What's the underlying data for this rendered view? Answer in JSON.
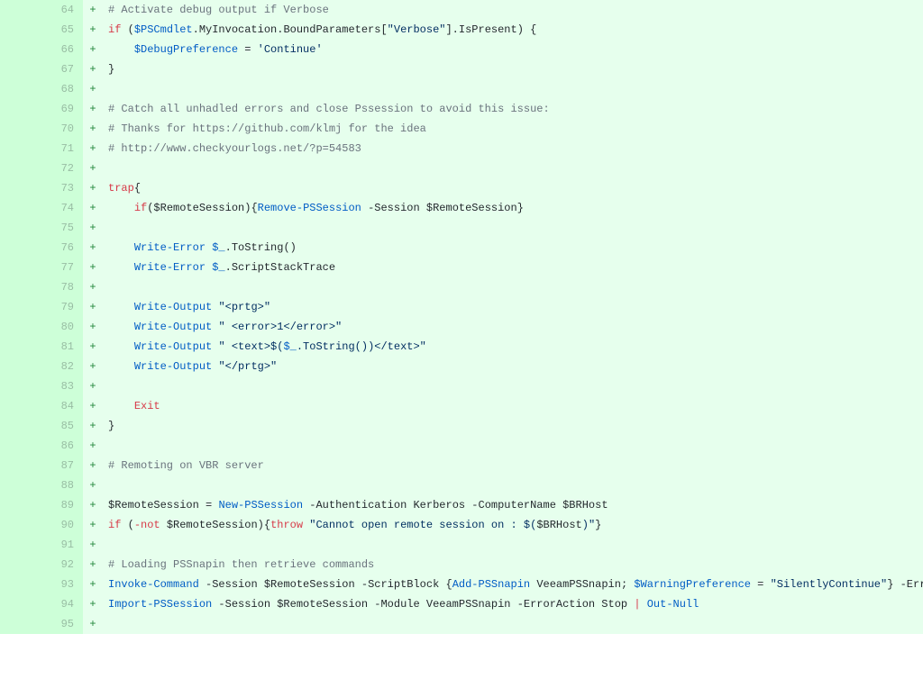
{
  "lines": [
    {
      "n": 64,
      "marker": "+",
      "tokens": [
        {
          "cls": "tok-comment",
          "t": "# Activate debug output if Verbose"
        }
      ]
    },
    {
      "n": 65,
      "marker": "+",
      "tokens": [
        {
          "cls": "tok-keyword",
          "t": "if"
        },
        {
          "cls": "tok-punct",
          "t": " ("
        },
        {
          "cls": "tok-builtin",
          "t": "$PSCmdlet"
        },
        {
          "cls": "tok-punct",
          "t": ".MyInvocation.BoundParameters["
        },
        {
          "cls": "tok-string",
          "t": "\"Verbose\""
        },
        {
          "cls": "tok-punct",
          "t": "].IsPresent) {"
        }
      ]
    },
    {
      "n": 66,
      "marker": "+",
      "tokens": [
        {
          "cls": "",
          "t": "    "
        },
        {
          "cls": "tok-builtin",
          "t": "$DebugPreference"
        },
        {
          "cls": "tok-punct",
          "t": " = "
        },
        {
          "cls": "tok-string",
          "t": "'Continue'"
        }
      ]
    },
    {
      "n": 67,
      "marker": "+",
      "tokens": [
        {
          "cls": "tok-punct",
          "t": "}"
        }
      ]
    },
    {
      "n": 68,
      "marker": "+",
      "tokens": []
    },
    {
      "n": 69,
      "marker": "+",
      "tokens": [
        {
          "cls": "tok-comment",
          "t": "# Catch all unhadled errors and close Pssession to avoid this issue:"
        }
      ]
    },
    {
      "n": 70,
      "marker": "+",
      "tokens": [
        {
          "cls": "tok-comment",
          "t": "# Thanks for https://github.com/klmj for the idea"
        }
      ]
    },
    {
      "n": 71,
      "marker": "+",
      "tokens": [
        {
          "cls": "tok-comment",
          "t": "# http://www.checkyourlogs.net/?p=54583"
        }
      ]
    },
    {
      "n": 72,
      "marker": "+",
      "tokens": []
    },
    {
      "n": 73,
      "marker": "+",
      "tokens": [
        {
          "cls": "tok-keyword",
          "t": "trap"
        },
        {
          "cls": "tok-punct",
          "t": "{"
        }
      ]
    },
    {
      "n": 74,
      "marker": "+",
      "tokens": [
        {
          "cls": "",
          "t": "    "
        },
        {
          "cls": "tok-keyword",
          "t": "if"
        },
        {
          "cls": "tok-punct",
          "t": "("
        },
        {
          "cls": "tok-variable",
          "t": "$RemoteSession"
        },
        {
          "cls": "tok-punct",
          "t": "){"
        },
        {
          "cls": "tok-cmdlet",
          "t": "Remove-PSSession"
        },
        {
          "cls": "",
          "t": " "
        },
        {
          "cls": "tok-punct",
          "t": "-Session "
        },
        {
          "cls": "tok-variable",
          "t": "$RemoteSession"
        },
        {
          "cls": "tok-punct",
          "t": "}"
        }
      ]
    },
    {
      "n": 75,
      "marker": "+",
      "tokens": []
    },
    {
      "n": 76,
      "marker": "+",
      "tokens": [
        {
          "cls": "",
          "t": "    "
        },
        {
          "cls": "tok-cmdlet",
          "t": "Write-Error"
        },
        {
          "cls": "",
          "t": " "
        },
        {
          "cls": "tok-builtin",
          "t": "$_"
        },
        {
          "cls": "tok-punct",
          "t": ".ToString()"
        }
      ]
    },
    {
      "n": 77,
      "marker": "+",
      "tokens": [
        {
          "cls": "",
          "t": "    "
        },
        {
          "cls": "tok-cmdlet",
          "t": "Write-Error"
        },
        {
          "cls": "",
          "t": " "
        },
        {
          "cls": "tok-builtin",
          "t": "$_"
        },
        {
          "cls": "tok-punct",
          "t": ".ScriptStackTrace"
        }
      ]
    },
    {
      "n": 78,
      "marker": "+",
      "tokens": []
    },
    {
      "n": 79,
      "marker": "+",
      "tokens": [
        {
          "cls": "",
          "t": "    "
        },
        {
          "cls": "tok-cmdlet",
          "t": "Write-Output"
        },
        {
          "cls": "",
          "t": " "
        },
        {
          "cls": "tok-string",
          "t": "\"<prtg>\""
        }
      ]
    },
    {
      "n": 80,
      "marker": "+",
      "tokens": [
        {
          "cls": "",
          "t": "    "
        },
        {
          "cls": "tok-cmdlet",
          "t": "Write-Output"
        },
        {
          "cls": "",
          "t": " "
        },
        {
          "cls": "tok-string",
          "t": "\" <error>1</error>\""
        }
      ]
    },
    {
      "n": 81,
      "marker": "+",
      "tokens": [
        {
          "cls": "",
          "t": "    "
        },
        {
          "cls": "tok-cmdlet",
          "t": "Write-Output"
        },
        {
          "cls": "",
          "t": " "
        },
        {
          "cls": "tok-string",
          "t": "\" <text>$("
        },
        {
          "cls": "tok-builtin",
          "t": "$_"
        },
        {
          "cls": "tok-string",
          "t": ".ToString())</text>\""
        }
      ]
    },
    {
      "n": 82,
      "marker": "+",
      "tokens": [
        {
          "cls": "",
          "t": "    "
        },
        {
          "cls": "tok-cmdlet",
          "t": "Write-Output"
        },
        {
          "cls": "",
          "t": " "
        },
        {
          "cls": "tok-string",
          "t": "\"</prtg>\""
        }
      ]
    },
    {
      "n": 83,
      "marker": "+",
      "tokens": []
    },
    {
      "n": 84,
      "marker": "+",
      "tokens": [
        {
          "cls": "",
          "t": "    "
        },
        {
          "cls": "tok-keyword",
          "t": "Exit"
        }
      ]
    },
    {
      "n": 85,
      "marker": "+",
      "tokens": [
        {
          "cls": "tok-punct",
          "t": "}"
        }
      ]
    },
    {
      "n": 86,
      "marker": "+",
      "tokens": []
    },
    {
      "n": 87,
      "marker": "+",
      "tokens": [
        {
          "cls": "tok-comment",
          "t": "# Remoting on VBR server"
        }
      ]
    },
    {
      "n": 88,
      "marker": "+",
      "tokens": []
    },
    {
      "n": 89,
      "marker": "+",
      "tokens": [
        {
          "cls": "tok-variable",
          "t": "$RemoteSession"
        },
        {
          "cls": "tok-punct",
          "t": " = "
        },
        {
          "cls": "tok-cmdlet",
          "t": "New-PSSession"
        },
        {
          "cls": "",
          "t": " -Authentication Kerberos -ComputerName "
        },
        {
          "cls": "tok-variable",
          "t": "$BRHost"
        }
      ]
    },
    {
      "n": 90,
      "marker": "+",
      "tokens": [
        {
          "cls": "tok-keyword",
          "t": "if"
        },
        {
          "cls": "tok-punct",
          "t": " ("
        },
        {
          "cls": "tok-keyword",
          "t": "-not"
        },
        {
          "cls": "",
          "t": " "
        },
        {
          "cls": "tok-variable",
          "t": "$RemoteSession"
        },
        {
          "cls": "tok-punct",
          "t": "){"
        },
        {
          "cls": "tok-keyword",
          "t": "throw"
        },
        {
          "cls": "",
          "t": " "
        },
        {
          "cls": "tok-string",
          "t": "\"Cannot open remote session on : $("
        },
        {
          "cls": "tok-variable",
          "t": "$BRHost"
        },
        {
          "cls": "tok-string",
          "t": ")\""
        },
        {
          "cls": "tok-punct",
          "t": "}"
        }
      ]
    },
    {
      "n": 91,
      "marker": "+",
      "tokens": []
    },
    {
      "n": 92,
      "marker": "+",
      "tokens": [
        {
          "cls": "tok-comment",
          "t": "# Loading PSSnapin then retrieve commands"
        }
      ]
    },
    {
      "n": 93,
      "marker": "+",
      "tokens": [
        {
          "cls": "tok-cmdlet",
          "t": "Invoke-Command"
        },
        {
          "cls": "",
          "t": " -Session "
        },
        {
          "cls": "tok-variable",
          "t": "$RemoteSession"
        },
        {
          "cls": "",
          "t": " -ScriptBlock {"
        },
        {
          "cls": "tok-cmdlet",
          "t": "Add-PSSnapin"
        },
        {
          "cls": "",
          "t": " VeeamPSSnapin; "
        },
        {
          "cls": "tok-builtin",
          "t": "$WarningPreference"
        },
        {
          "cls": "tok-punct",
          "t": " = "
        },
        {
          "cls": "tok-string",
          "t": "\"SilentlyContinue\""
        },
        {
          "cls": "tok-punct",
          "t": "} -ErrorA"
        }
      ]
    },
    {
      "n": 94,
      "marker": "+",
      "tokens": [
        {
          "cls": "tok-cmdlet",
          "t": "Import-PSSession"
        },
        {
          "cls": "",
          "t": " -Session "
        },
        {
          "cls": "tok-variable",
          "t": "$RemoteSession"
        },
        {
          "cls": "",
          "t": " -Module VeeamPSSnapin -ErrorAction Stop "
        },
        {
          "cls": "tok-pipe",
          "t": "|"
        },
        {
          "cls": "",
          "t": " "
        },
        {
          "cls": "tok-cmdlet",
          "t": "Out-Null"
        }
      ]
    },
    {
      "n": 95,
      "marker": "+",
      "tokens": []
    }
  ]
}
